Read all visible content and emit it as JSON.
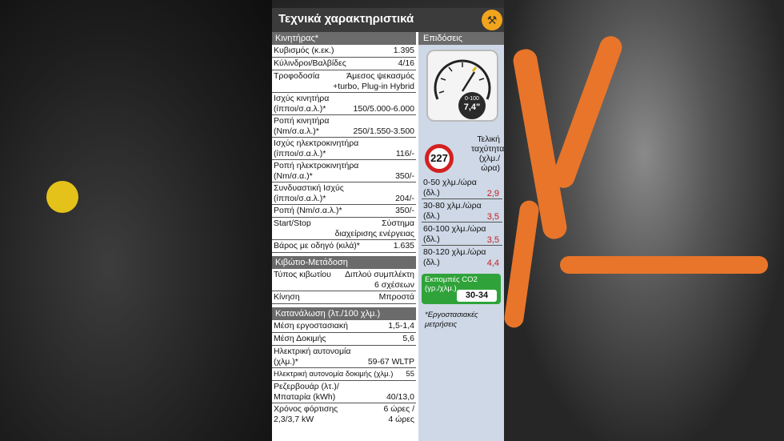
{
  "header": {
    "title": "Τεχνικά χαρακτηριστικά",
    "icon": "tools-icon"
  },
  "engine": {
    "section": "Κινητήρας*",
    "rows": [
      {
        "label": "Κυβισμός (κ.εκ.)",
        "value": "1.395"
      },
      {
        "label": "Κύλινδροι/Βαλβίδες",
        "value": "4/16"
      },
      {
        "label": "Τροφοδοσία",
        "value1": "Άμεσος ψεκασμός",
        "value2": "+turbo, Plug-in Hybrid"
      },
      {
        "label1": "Ισχύς κινητήρα",
        "label2": "(ίπποι/σ.α.λ.)*",
        "value": "150/5.000-6.000"
      },
      {
        "label1": "Ροπή κινητήρα",
        "label2": "(Nm/σ.α.λ.)*",
        "value": "250/1.550-3.500"
      },
      {
        "label1": "Ισχύς ηλεκτροκινητήρα",
        "label2": "(ίπποι/σ.α.λ.)*",
        "value": "116/-"
      },
      {
        "label1": "Ροπή ηλεκτροκινητήρα",
        "label2": "(Nm/σ.α.)*",
        "value": "350/-"
      },
      {
        "label1": "Συνδυαστική Ισχύς",
        "label2": "(ίπποι/σ.α.λ.)*",
        "value": "204/-"
      },
      {
        "label": "Ροπή (Nm/σ.α.λ.)*",
        "value": "350/-"
      },
      {
        "label": "Start/Stop",
        "value1": "Σύστημα",
        "value2": "διαχείρισης ενέργειας"
      },
      {
        "label": "Βάρος με οδηγό (κιλά)*",
        "value": "1.635"
      }
    ]
  },
  "gearbox": {
    "section": "Κιβώτιο-Μετάδοση",
    "rows": [
      {
        "label": "Τύπος κιβωτίου",
        "value1": "Διπλού συμπλέκτη",
        "value2": "6 σχέσεων"
      },
      {
        "label": "Κίνηση",
        "value": "Μπροστά"
      }
    ]
  },
  "consumption": {
    "section": "Κατανάλωση (λτ./100 χλμ.)",
    "rows": [
      {
        "label": "Μέση εργοστασιακή",
        "value": "1,5-1,4"
      },
      {
        "label": "Μέση Δοκιμής",
        "value": "5,6"
      },
      {
        "label1": "Ηλεκτρική αυτονομία",
        "label2": "(χλμ.)*",
        "value": "59-67 WLTP"
      },
      {
        "label": "Ηλεκτρική αυτονομία δοκιμής (χλμ.)",
        "value": "55"
      },
      {
        "label1": "Ρεζερβουάρ (λτ.)/",
        "label2": "Μπαταρία (kWh)",
        "value": "40/13,0"
      },
      {
        "label1": "Χρόνος φόρτισης",
        "label2": "2,3/3,7 kW",
        "value1": "6 ώρες /",
        "value2": "4 ώρες"
      }
    ]
  },
  "performance": {
    "section": "Επιδόσεις",
    "gauge_label": "0-100",
    "gauge_value": "7,4",
    "gauge_unit": "\"",
    "top_speed": "227",
    "top_speed_label": [
      "Τελική",
      "ταχύτητα",
      "(χλμ./",
      "ώρα)"
    ],
    "accel": [
      {
        "l1": "0-50 χλμ./ώρα",
        "l2": "(δλ.)",
        "value": "2,9"
      },
      {
        "l1": "30-80 χλμ./ώρα",
        "l2": "(δλ.)",
        "value": "3,5"
      },
      {
        "l1": "60-100 χλμ./ώρα",
        "l2": "(δλ.)",
        "value": "3,5"
      },
      {
        "l1": "80-120 χλμ./ώρα",
        "l2": "(δλ.)",
        "value": "4,4"
      }
    ],
    "co2_label1": "Εκπομπές CO2",
    "co2_label2": "(γρ./χλμ.)",
    "co2_value": "30-34",
    "note1": "*Εργοστασιακές",
    "note2": "μετρήσεις"
  },
  "colors": {
    "accent": "#f2a41c",
    "header": "#3b3b3b",
    "section": "#6b6b6b",
    "perf_bg": "#ced8e6",
    "red": "#c62020",
    "green": "#2fa33a"
  }
}
